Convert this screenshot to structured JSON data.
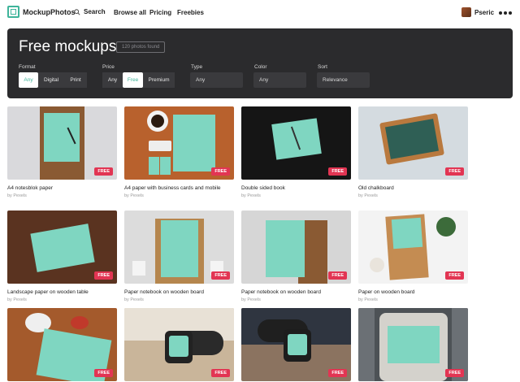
{
  "nav": {
    "logo_text": "MockupPhotos",
    "search_label": "Search",
    "links": [
      "Browse all",
      "Pricing",
      "Freebies"
    ],
    "username": "Pseric"
  },
  "panel": {
    "title": "Free mockups",
    "count_badge": "120 photos found",
    "format": {
      "label": "Format",
      "options": [
        "Any",
        "Digital",
        "Print"
      ],
      "selected": "Any"
    },
    "price": {
      "label": "Price",
      "options": [
        "Any",
        "Free",
        "Premium"
      ],
      "selected": "Free"
    },
    "type": {
      "label": "Type",
      "value": "Any"
    },
    "color": {
      "label": "Color",
      "value": "Any"
    },
    "sort": {
      "label": "Sort",
      "value": "Relevance"
    }
  },
  "badge_label": "FREE",
  "cards": [
    {
      "title": "A4 notesblok paper",
      "by": "by Pexels"
    },
    {
      "title": "A4 paper with business cards and mobile",
      "by": "by Pexels"
    },
    {
      "title": "Double sided book",
      "by": "by Pexels"
    },
    {
      "title": "Old chalkboard",
      "by": "by Pexels"
    },
    {
      "title": "Landscape paper on wooden table",
      "by": "by Pexels"
    },
    {
      "title": "Paper notebook on wooden board",
      "by": "by Pexels"
    },
    {
      "title": "Paper notebook on wooden board",
      "by": "by Pexels"
    },
    {
      "title": "Paper on wooden board",
      "by": "by Pexels"
    },
    {
      "title": "",
      "by": ""
    },
    {
      "title": "",
      "by": ""
    },
    {
      "title": "",
      "by": ""
    },
    {
      "title": "",
      "by": ""
    }
  ],
  "colors": {
    "accent": "#3fb49a",
    "mockup_paper": "#7fd6c1",
    "badge": "#e23553",
    "panel": "#2b2b2d"
  }
}
